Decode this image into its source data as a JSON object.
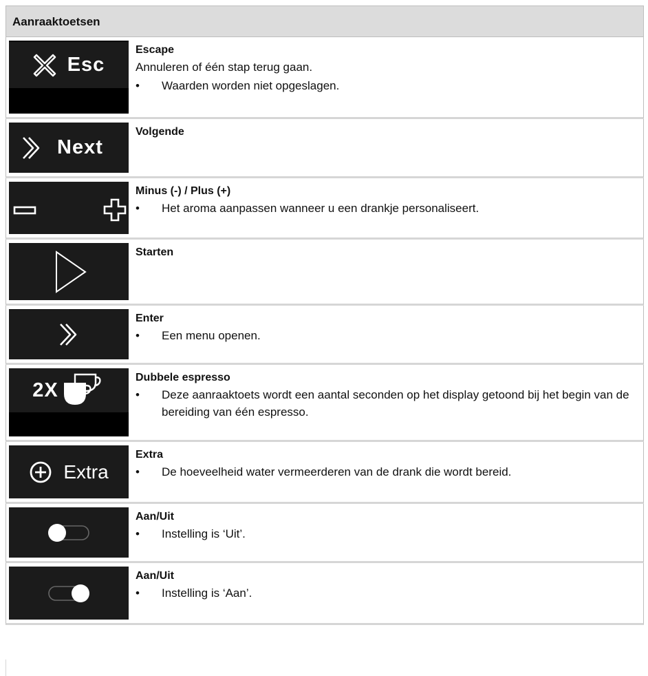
{
  "table": {
    "header": "Aanraaktoetsen",
    "rows": [
      {
        "key_label": "Esc",
        "icon": "cross-icon",
        "title": "Escape",
        "plain": "Annuleren of één stap terug gaan.",
        "bullets": [
          "Waarden worden niet opgeslagen."
        ]
      },
      {
        "key_label": "Next",
        "icon": "next-chevron-icon",
        "title": "Volgende",
        "plain": "",
        "bullets": []
      },
      {
        "key_label": "",
        "icon": "minus-plus-icon",
        "title": "Minus (-) / Plus (+)",
        "plain": "",
        "bullets": [
          "Het aroma aanpassen wanneer u een drankje personaliseert."
        ]
      },
      {
        "key_label": "",
        "icon": "play-triangle-icon",
        "title": "Starten",
        "plain": "",
        "bullets": []
      },
      {
        "key_label": "",
        "icon": "enter-chevron-icon",
        "title": "Enter",
        "plain": "",
        "bullets": [
          "Een menu openen."
        ]
      },
      {
        "key_label": "2X",
        "icon": "double-espresso-cups-icon",
        "title": "Dubbele espresso",
        "plain": "",
        "bullets": [
          "Deze aanraaktoets wordt een aantal seconden op het display getoond bij het begin van de bereiding van één espresso."
        ]
      },
      {
        "key_label": "Extra",
        "icon": "circle-plus-icon",
        "title": "Extra",
        "plain": "",
        "bullets": [
          "De hoeveelheid water vermeerderen van de drank die wordt bereid."
        ]
      },
      {
        "key_label": "",
        "icon": "toggle-off-icon",
        "title": "Aan/Uit",
        "plain": "",
        "bullets": [
          "Instelling is ‘Uit’."
        ]
      },
      {
        "key_label": "",
        "icon": "toggle-on-icon",
        "title": "Aan/Uit",
        "plain": "",
        "bullets": [
          "Instelling is ‘Aan’."
        ]
      }
    ]
  }
}
